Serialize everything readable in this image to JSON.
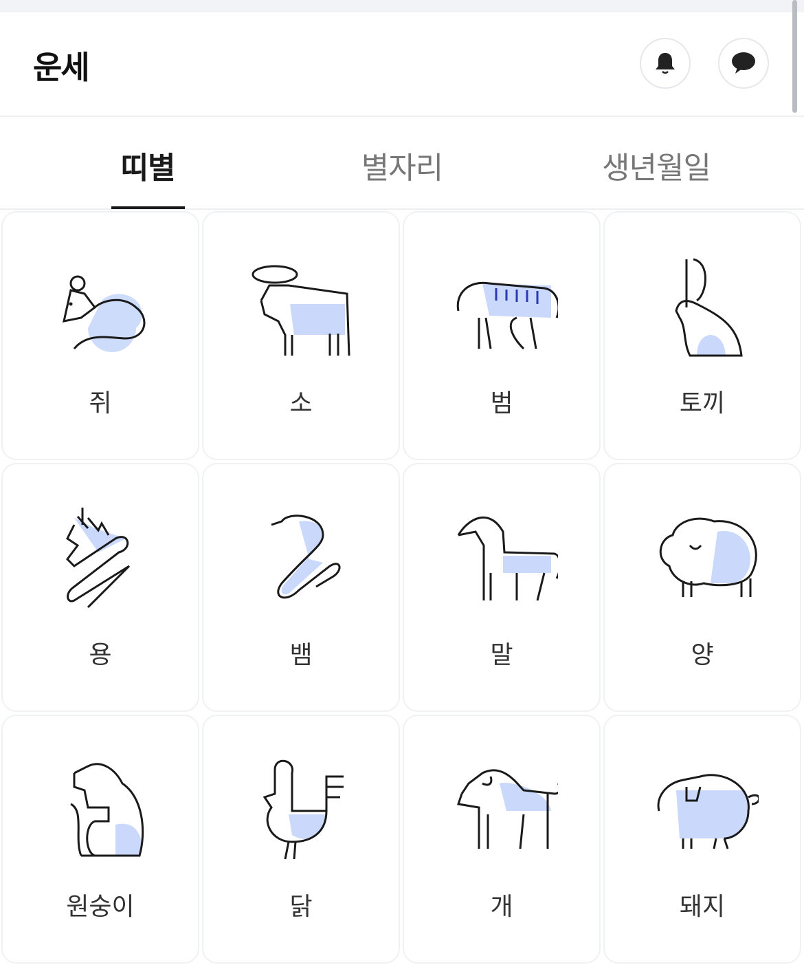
{
  "header": {
    "title": "운세",
    "bell_icon": "bell-icon",
    "chat_icon": "chat-bubble-icon"
  },
  "tabs": [
    {
      "label": "띠별",
      "active": true
    },
    {
      "label": "별자리",
      "active": false
    },
    {
      "label": "생년월일",
      "active": false
    }
  ],
  "zodiac": [
    {
      "label": "쥐",
      "icon": "rat-icon"
    },
    {
      "label": "소",
      "icon": "ox-icon"
    },
    {
      "label": "범",
      "icon": "tiger-icon"
    },
    {
      "label": "토끼",
      "icon": "rabbit-icon"
    },
    {
      "label": "용",
      "icon": "dragon-icon"
    },
    {
      "label": "뱀",
      "icon": "snake-icon"
    },
    {
      "label": "말",
      "icon": "horse-icon"
    },
    {
      "label": "양",
      "icon": "sheep-icon"
    },
    {
      "label": "원숭이",
      "icon": "monkey-icon"
    },
    {
      "label": "닭",
      "icon": "rooster-icon"
    },
    {
      "label": "개",
      "icon": "dog-icon"
    },
    {
      "label": "돼지",
      "icon": "pig-icon"
    }
  ],
  "colors": {
    "accent_fill": "#c9d8fb",
    "line": "#1a1a1a",
    "tab_active": "#1a1a1a",
    "tab_inactive": "#777777"
  }
}
